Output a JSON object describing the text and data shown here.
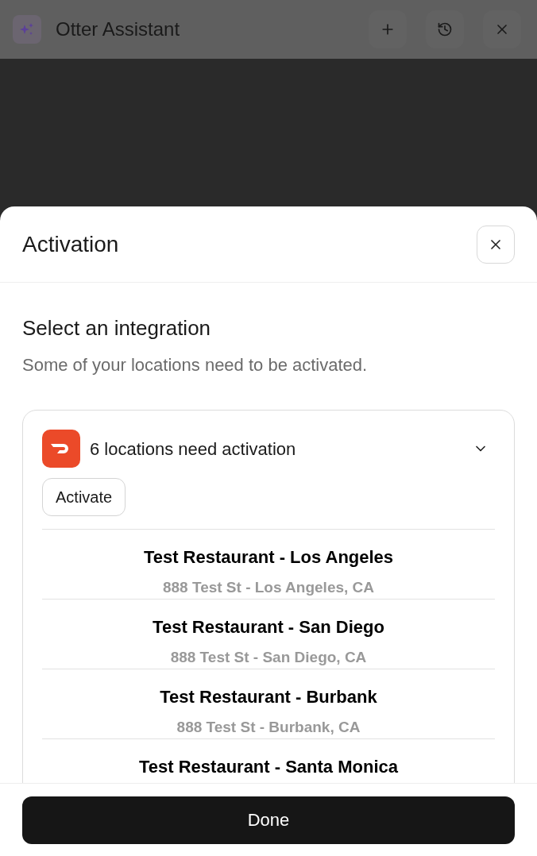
{
  "top_bar": {
    "title": "Otter Assistant"
  },
  "sheet": {
    "title": "Activation",
    "heading": "Select an integration",
    "subtitle": "Some of your locations need to be activated.",
    "integration": {
      "summary": "6 locations need activation",
      "expanded": true,
      "action": "Activate",
      "locations": [
        {
          "name": "Test Restaurant - Los Angeles",
          "address": "888 Test St - Los Angeles, CA"
        },
        {
          "name": "Test Restaurant - San Diego",
          "address": "888 Test St - San Diego, CA"
        },
        {
          "name": "Test Restaurant - Burbank",
          "address": "888 Test St - Burbank, CA"
        },
        {
          "name": "Test Restaurant - Santa Monica"
        }
      ]
    }
  },
  "footer": {
    "button": "Done"
  }
}
